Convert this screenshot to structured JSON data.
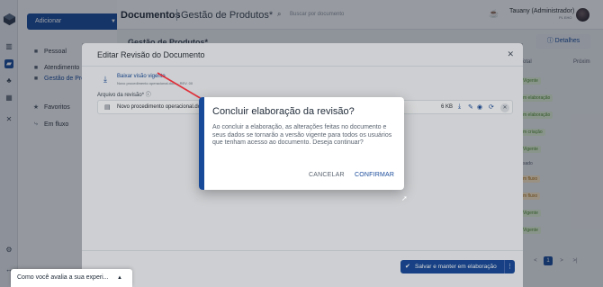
{
  "sidebar": {
    "add_button": "Adicionar",
    "items": [
      {
        "label": "Pessoal",
        "icon": "folder-icon"
      },
      {
        "label": "Atendimento",
        "icon": "folder-icon"
      },
      {
        "label": "Gestão de Produ",
        "icon": "folder-icon"
      },
      {
        "label": "Favoritos",
        "icon": "star-icon"
      },
      {
        "label": "Em fluxo",
        "icon": "flow-icon"
      }
    ]
  },
  "topbar": {
    "title": "Documentos",
    "subtitle": "Gestão de Produtos*",
    "search_placeholder": "Buscar por documento",
    "user_name": "Tauany (Administrador)",
    "user_sub": "PL EHO"
  },
  "page": {
    "title": "Gestão de Produtos*",
    "details_button": "Detalhes",
    "col_total": "Total",
    "col_next": "Próxim",
    "tags": [
      {
        "text": "Vigente",
        "kind": "green"
      },
      {
        "text": "m elaboração",
        "kind": "green"
      },
      {
        "text": "m elaboração",
        "kind": "green"
      },
      {
        "text": "m criação",
        "kind": "green"
      },
      {
        "text": "Vigente",
        "kind": "green"
      },
      {
        "text": "sado",
        "kind": "plain"
      },
      {
        "text": "m fluxo",
        "kind": "orange"
      },
      {
        "text": "m fluxo",
        "kind": "orange"
      },
      {
        "text": "Vigente",
        "kind": "green"
      },
      {
        "text": "Vigente",
        "kind": "green"
      }
    ],
    "pagination": [
      "<",
      "1",
      ">",
      ">|"
    ]
  },
  "modal": {
    "title": "Editar Revisão do Documento",
    "download_label": "Baixar visão vigente",
    "download_sub": "Novo procedimento operacional.docx - REV. 00",
    "file_field_label": "Arquivo da revisão*",
    "file_name": "Novo procedimento operacional.docx",
    "file_size": "6 KB",
    "save_button": "Salvar e manter em elaboração"
  },
  "dialog": {
    "title": "Concluir elaboração da revisão?",
    "body": "Ao concluir a elaboração, as alterações feitas no documento e seus dados se tornarão a versão vigente para todos os usuários que tenham acesso ao documento. Deseja continuar?",
    "cancel": "CANCELAR",
    "confirm": "CONFIRMAR"
  },
  "toast": {
    "text": "Como você avalia a sua experi..."
  },
  "colors": {
    "primary": "#184a9a",
    "arrow": "#e0303a"
  }
}
